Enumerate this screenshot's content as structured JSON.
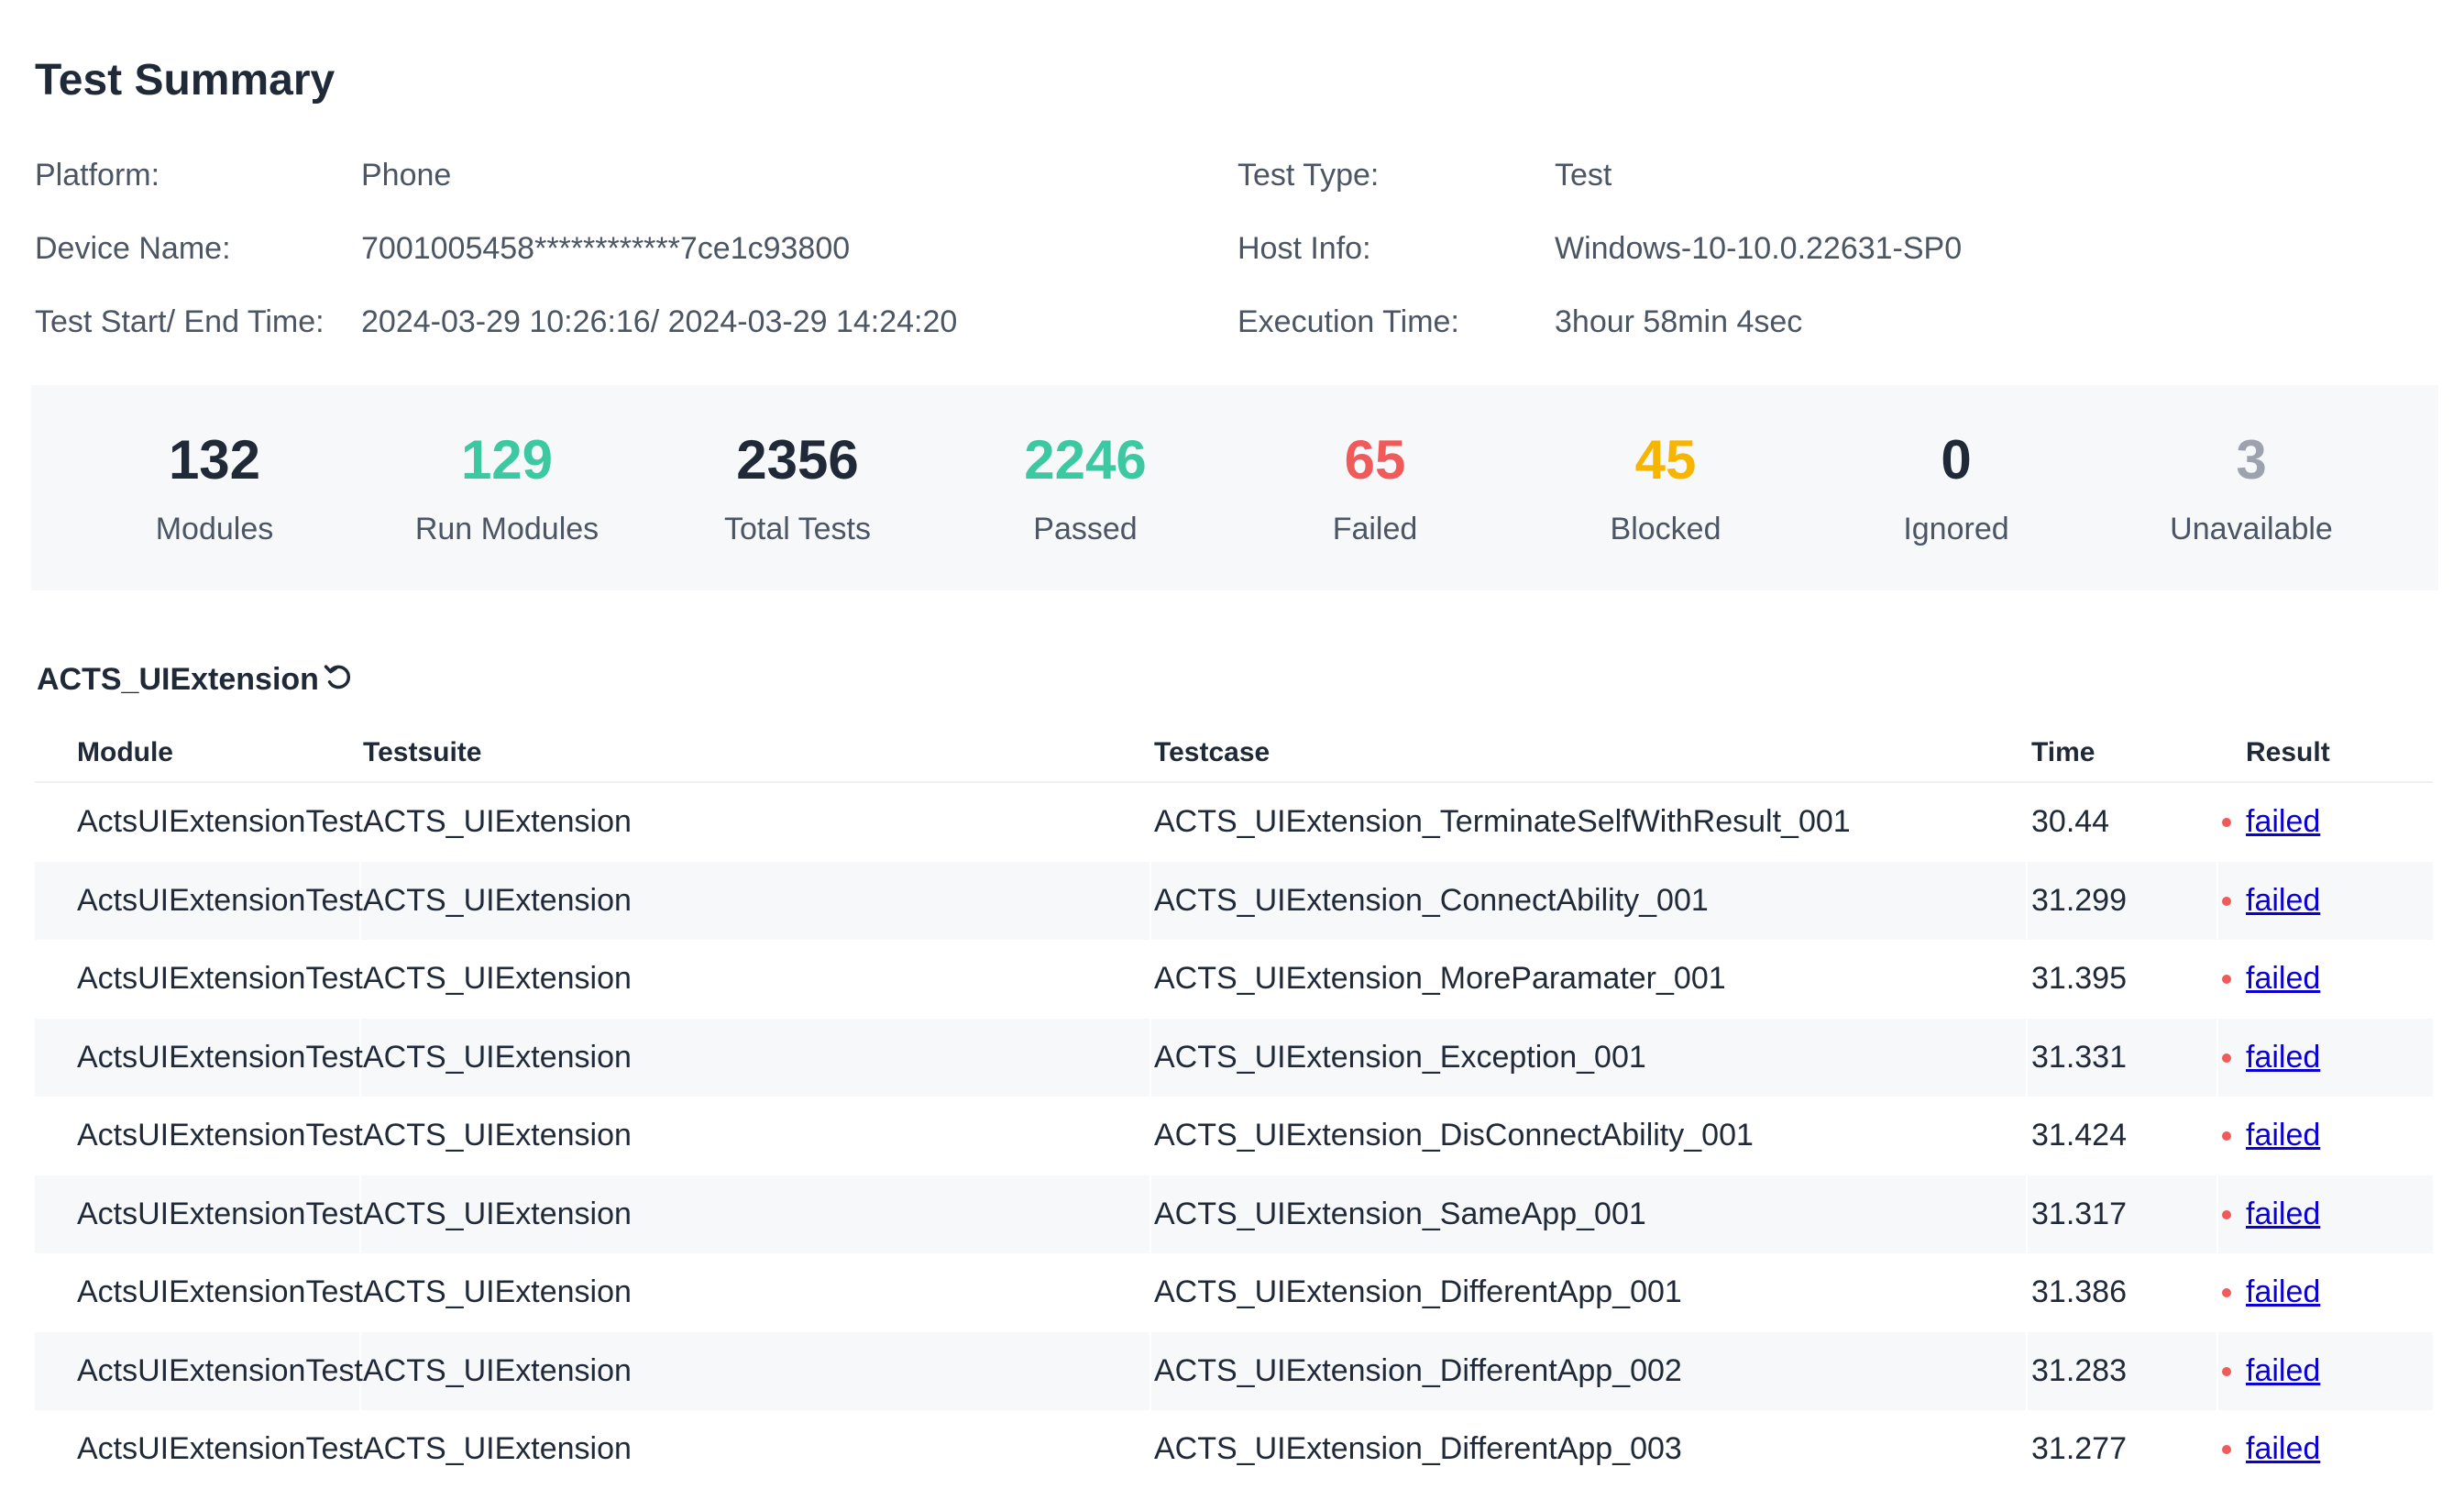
{
  "summary": {
    "title": "Test Summary",
    "left": [
      {
        "label": "Platform:",
        "value": "Phone"
      },
      {
        "label": "Device Name:",
        "value": "7001005458************7ce1c93800"
      },
      {
        "label": "Test Start/ End Time:",
        "value": "2024-03-29 10:26:16/ 2024-03-29 14:24:20"
      }
    ],
    "right": [
      {
        "label": "Test Type:",
        "value": "Test"
      },
      {
        "label": "Host Info:",
        "value": "Windows-10-10.0.22631-SP0"
      },
      {
        "label": "Execution Time:",
        "value": "3hour 58min 4sec"
      }
    ]
  },
  "stats": [
    {
      "value": "132",
      "label": "Modules",
      "color": "#1f2937"
    },
    {
      "value": "129",
      "label": "Run Modules",
      "color": "#3cc8a0"
    },
    {
      "value": "2356",
      "label": "Total Tests",
      "color": "#1f2937"
    },
    {
      "value": "2246",
      "label": "Passed",
      "color": "#3cc8a0"
    },
    {
      "value": "65",
      "label": "Failed",
      "color": "#f05a5a"
    },
    {
      "value": "45",
      "label": "Blocked",
      "color": "#f7b500"
    },
    {
      "value": "0",
      "label": "Ignored",
      "color": "#1f2937"
    },
    {
      "value": "3",
      "label": "Unavailable",
      "color": "#9ca3af"
    }
  ],
  "section": {
    "title": "ACTS_UIExtension",
    "refresh_icon": "refresh-icon"
  },
  "table": {
    "headers": [
      "Module",
      "Testsuite",
      "Testcase",
      "Time",
      "Result"
    ],
    "rows": [
      {
        "module": "ActsUIExtensionTest",
        "suite": "ACTS_UIExtension",
        "case": "ACTS_UIExtension_TerminateSelfWithResult_001",
        "time": "30.44",
        "result": "failed"
      },
      {
        "module": "ActsUIExtensionTest",
        "suite": "ACTS_UIExtension",
        "case": "ACTS_UIExtension_ConnectAbility_001",
        "time": "31.299",
        "result": "failed"
      },
      {
        "module": "ActsUIExtensionTest",
        "suite": "ACTS_UIExtension",
        "case": "ACTS_UIExtension_MoreParamater_001",
        "time": "31.395",
        "result": "failed"
      },
      {
        "module": "ActsUIExtensionTest",
        "suite": "ACTS_UIExtension",
        "case": "ACTS_UIExtension_Exception_001",
        "time": "31.331",
        "result": "failed"
      },
      {
        "module": "ActsUIExtensionTest",
        "suite": "ACTS_UIExtension",
        "case": "ACTS_UIExtension_DisConnectAbility_001",
        "time": "31.424",
        "result": "failed"
      },
      {
        "module": "ActsUIExtensionTest",
        "suite": "ACTS_UIExtension",
        "case": "ACTS_UIExtension_SameApp_001",
        "time": "31.317",
        "result": "failed"
      },
      {
        "module": "ActsUIExtensionTest",
        "suite": "ACTS_UIExtension",
        "case": "ACTS_UIExtension_DifferentApp_001",
        "time": "31.386",
        "result": "failed"
      },
      {
        "module": "ActsUIExtensionTest",
        "suite": "ACTS_UIExtension",
        "case": "ACTS_UIExtension_DifferentApp_002",
        "time": "31.283",
        "result": "failed"
      },
      {
        "module": "ActsUIExtensionTest",
        "suite": "ACTS_UIExtension",
        "case": "ACTS_UIExtension_DifferentApp_003",
        "time": "31.277",
        "result": "failed"
      }
    ]
  },
  "colors": {
    "failed_dot": "#f05a5a",
    "link": "#0b00d6",
    "stats_bg": "#f7f8fa"
  }
}
